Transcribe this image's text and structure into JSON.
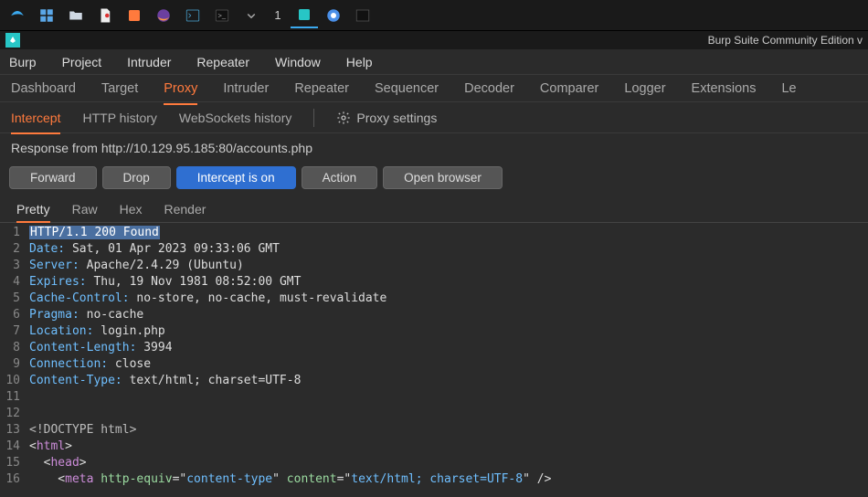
{
  "taskbar": {
    "workspace_number": "1"
  },
  "titlebar": {
    "title": "Burp Suite Community Edition v"
  },
  "menubar": [
    "Burp",
    "Project",
    "Intruder",
    "Repeater",
    "Window",
    "Help"
  ],
  "tabs": [
    {
      "label": "Dashboard"
    },
    {
      "label": "Target"
    },
    {
      "label": "Proxy",
      "active": true
    },
    {
      "label": "Intruder"
    },
    {
      "label": "Repeater"
    },
    {
      "label": "Sequencer"
    },
    {
      "label": "Decoder"
    },
    {
      "label": "Comparer"
    },
    {
      "label": "Logger"
    },
    {
      "label": "Extensions"
    },
    {
      "label": "Le"
    }
  ],
  "subtabs": {
    "items": [
      {
        "label": "Intercept",
        "active": true
      },
      {
        "label": "HTTP history"
      },
      {
        "label": "WebSockets history"
      }
    ],
    "proxy_settings_label": "Proxy settings"
  },
  "info_row": "Response from http://10.129.95.185:80/accounts.php",
  "actions": {
    "forward": "Forward",
    "drop": "Drop",
    "intercept": "Intercept is on",
    "action": "Action",
    "open_browser": "Open browser"
  },
  "view_tabs": [
    "Pretty",
    "Raw",
    "Hex",
    "Render"
  ],
  "response": {
    "status_line": "HTTP/1.1 200 Found",
    "headers": [
      {
        "name": "Date",
        "value": "Sat, 01 Apr 2023 09:33:06 GMT"
      },
      {
        "name": "Server",
        "value": "Apache/2.4.29 (Ubuntu)"
      },
      {
        "name": "Expires",
        "value": "Thu, 19 Nov 1981 08:52:00 GMT"
      },
      {
        "name": "Cache-Control",
        "value": "no-store, no-cache, must-revalidate"
      },
      {
        "name": "Pragma",
        "value": "no-cache"
      },
      {
        "name": "Location",
        "value": "login.php"
      },
      {
        "name": "Content-Length",
        "value": "3994"
      },
      {
        "name": "Connection",
        "value": "close"
      },
      {
        "name": "Content-Type",
        "value": "text/html; charset=UTF-8"
      }
    ],
    "body_lines": [
      {
        "n": 11,
        "raw": ""
      },
      {
        "n": 12,
        "raw": ""
      },
      {
        "n": 13,
        "html": "<span class='doctype'>&lt;!DOCTYPE html&gt;</span>"
      },
      {
        "n": 14,
        "html": "&lt;<span class='tag'>html</span>&gt;"
      },
      {
        "n": 15,
        "html": "  &lt;<span class='tag'>head</span>&gt;"
      },
      {
        "n": 16,
        "html": "    &lt;<span class='tag'>meta</span> <span class='attr-n'>http-equiv</span>=\"<span class='attr-v'>content-type</span>\" <span class='attr-n'>content</span>=\"<span class='attr-v'>text/html; charset=UTF-8</span>\" /&gt;"
      }
    ]
  }
}
